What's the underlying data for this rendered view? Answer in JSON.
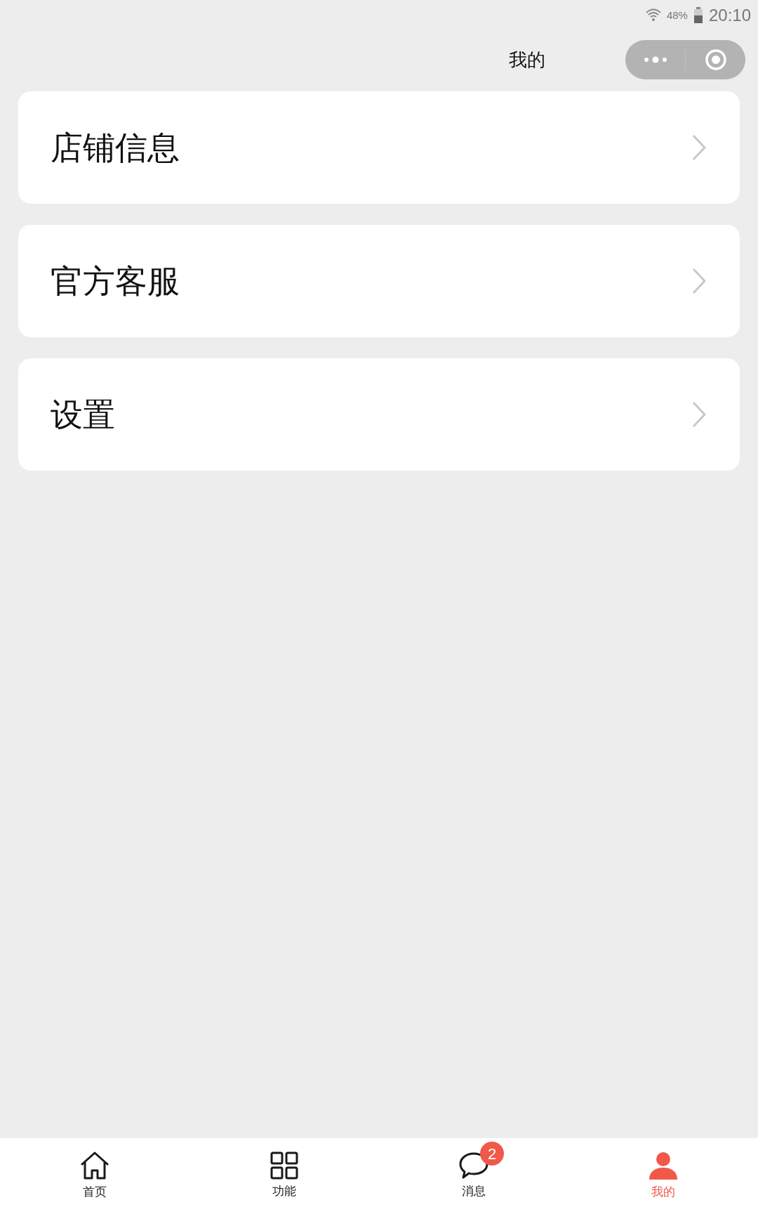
{
  "status_bar": {
    "battery": "48%",
    "time": "20:10"
  },
  "header": {
    "title": "我的"
  },
  "menu": [
    {
      "label": "店铺信息"
    },
    {
      "label": "官方客服"
    },
    {
      "label": "设置"
    }
  ],
  "tab_bar": [
    {
      "label": "首页",
      "kind": "home",
      "selected": false
    },
    {
      "label": "功能",
      "kind": "grid",
      "selected": false
    },
    {
      "label": "消息",
      "kind": "chat",
      "selected": false,
      "badge": "2"
    },
    {
      "label": "我的",
      "kind": "user",
      "selected": true
    }
  ]
}
